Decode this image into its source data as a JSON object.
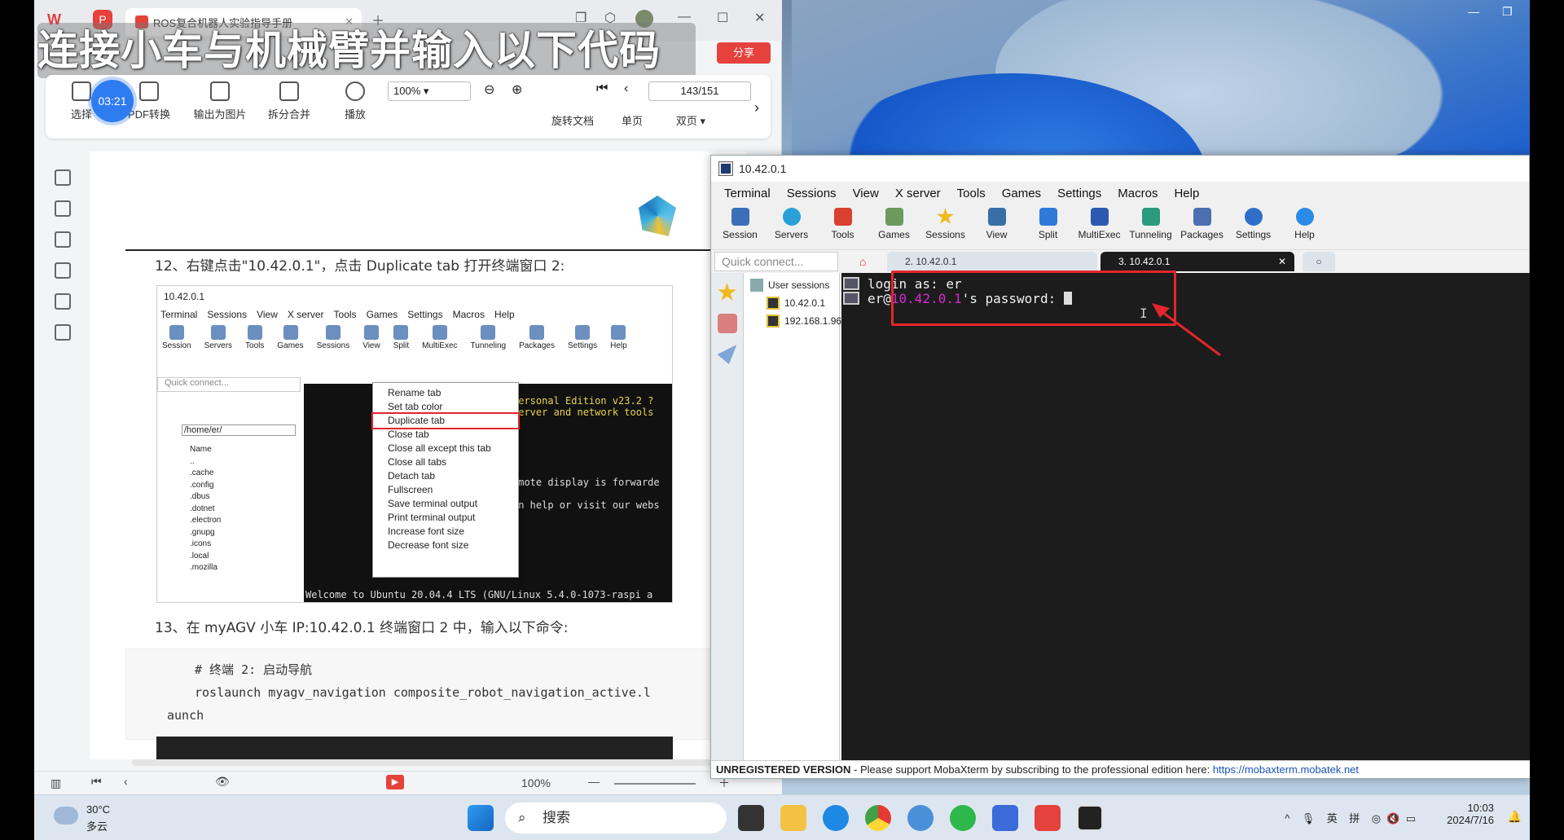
{
  "overlay_caption": "连接小车与机械臂并输入以下代码",
  "timer": "03:21",
  "wps": {
    "tab_title": "ROS复合机器人实验指导手册",
    "share_label": "分享",
    "tools": [
      "选择",
      "PDF转换",
      "输出为图片",
      "拆分合并",
      "播放",
      "旋转文档",
      "单页",
      "双页"
    ],
    "zoom": "100%",
    "page": "143/151",
    "status_zoom": "100%"
  },
  "doc": {
    "step12": "12、右键点击\"10.42.0.1\"，点击 Duplicate tab 打开终端窗口 2:",
    "step13": "13、在 myAGV 小车 IP:10.42.0.1 终端窗口 2 中，输入以下命令:",
    "code_comment": "# 终端 2: 启动导航",
    "code_line1": "roslaunch myagv_navigation composite_robot_navigation_active.l",
    "code_line2": "aunch",
    "inner_screenshot": {
      "title": "10.42.0.1",
      "menu": [
        "Terminal",
        "Sessions",
        "View",
        "X server",
        "Tools",
        "Games",
        "Settings",
        "Macros",
        "Help"
      ],
      "tools": [
        "Session",
        "Servers",
        "Tools",
        "Games",
        "Sessions",
        "View",
        "Split",
        "MultiExec",
        "Tunneling",
        "Packages",
        "Settings",
        "Help"
      ],
      "quick_connect": "Quick connect...",
      "path": "/home/er/",
      "files": [
        "Name",
        "..",
        ".cache",
        ".config",
        ".dbus",
        ".dotnet",
        ".electron",
        ".gnupg",
        ".icons",
        ".local",
        ".mozilla"
      ],
      "context_menu": [
        "Rename tab",
        "Set tab color",
        "Duplicate tab",
        "Close tab",
        "Close all except this tab",
        "Close all tabs",
        "Detach tab",
        "Fullscreen",
        "Save terminal output",
        "Print terminal output",
        "Increase font size",
        "Decrease font size"
      ],
      "term_lines": [
        "Personal Edition v23.2 ?",
        "server and network tools",
        "emote display is forwarde",
        "on help or visit our webs",
        "Welcome to Ubuntu 20.04.4 LTS (GNU/Linux 5.4.0-1073-raspi a"
      ]
    }
  },
  "moba": {
    "title": "10.42.0.1",
    "menu": [
      "Terminal",
      "Sessions",
      "View",
      "X server",
      "Tools",
      "Games",
      "Settings",
      "Macros",
      "Help"
    ],
    "tools": [
      "Session",
      "Servers",
      "Tools",
      "Games",
      "Sessions",
      "View",
      "Split",
      "MultiExec",
      "Tunneling",
      "Packages",
      "Settings",
      "Help"
    ],
    "quick_connect": "Quick connect...",
    "tab2": "2. 10.42.0.1",
    "tab3": "3. 10.42.0.1",
    "tree": [
      "User sessions",
      "10.42.0.1",
      "192.168.1.96"
    ],
    "term_login": "login as: er",
    "term_user": "er@",
    "term_host": "10.42.0.1",
    "term_pw": "'s password: ",
    "status_bold": "UNREGISTERED VERSION",
    "status_text": "  -  Please support MobaXterm by subscribing to the professional edition here:  ",
    "status_link": "https://mobaxterm.mobatek.net"
  },
  "taskbar": {
    "temp": "30°C",
    "weather": "多云",
    "search": "搜索",
    "ime1": "英",
    "ime2": "拼",
    "time": "10:03",
    "date": "2024/7/16"
  },
  "colors": {
    "accent": "#e3262b",
    "terminal_bg": "#1c1c1c",
    "host_magenta": "#d32ad3",
    "link": "#1a55b8"
  }
}
